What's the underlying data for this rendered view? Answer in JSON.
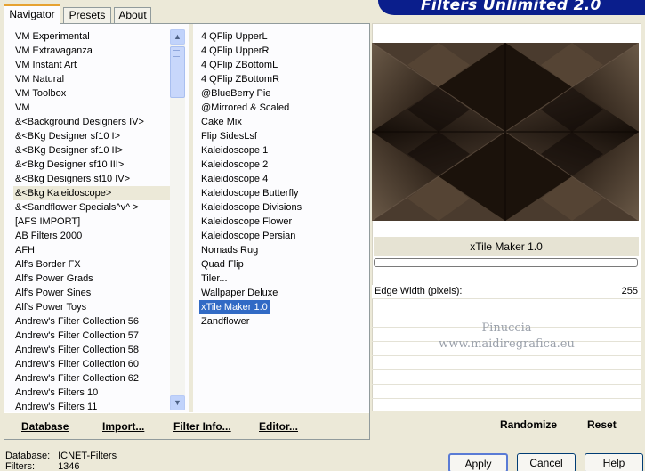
{
  "banner": {
    "title": "Filters Unlimited 2.0"
  },
  "tabs": [
    {
      "label": "Navigator"
    },
    {
      "label": "Presets"
    },
    {
      "label": "About"
    }
  ],
  "categories": [
    "VM Experimental",
    "VM Extravaganza",
    "VM Instant Art",
    "VM Natural",
    "VM Toolbox",
    "VM",
    "&<Background Designers IV>",
    "&<BKg Designer sf10 I>",
    "&<BKg Designer sf10 II>",
    "&<Bkg Designer sf10 III>",
    "&<Bkg Designers sf10 IV>",
    "&<Bkg Kaleidoscope>",
    "&<Sandflower Specials^v^ >",
    "[AFS IMPORT]",
    "AB Filters 2000",
    "AFH",
    "Alf's Border FX",
    "Alf's Power Grads",
    "Alf's Power Sines",
    "Alf's Power Toys",
    "Andrew's Filter Collection 56",
    "Andrew's Filter Collection 57",
    "Andrew's Filter Collection 58",
    "Andrew's Filter Collection 60",
    "Andrew's Filter Collection 62",
    "Andrew's Filters 10",
    "Andrew's Filters 11"
  ],
  "selected_category": "&<Bkg Kaleidoscope>",
  "filters": [
    "4 QFlip UpperL",
    "4 QFlip UpperR",
    "4 QFlip ZBottomL",
    "4 QFlip ZBottomR",
    "@BlueBerry Pie",
    "@Mirrored & Scaled",
    "Cake Mix",
    "Flip SidesLsf",
    "Kaleidoscope 1",
    "Kaleidoscope 2",
    "Kaleidoscope 4",
    "Kaleidoscope Butterfly",
    "Kaleidoscope Divisions",
    "Kaleidoscope Flower",
    "Kaleidoscope Persian",
    "Nomads Rug",
    "Quad Flip",
    "Tiler...",
    "Wallpaper Deluxe",
    "xTile Maker 1.0",
    "Zandflower"
  ],
  "selected_filter": "xTile Maker 1.0",
  "left_bottom": {
    "database": "Database",
    "import": "Import...",
    "filter_info": "Filter Info...",
    "editor": "Editor..."
  },
  "preview": {
    "filter_title": "xTile Maker 1.0",
    "progress": 0
  },
  "params": [
    {
      "label": "Edge Width (pixels):",
      "value": "255"
    }
  ],
  "watermark": {
    "line1": "Pinuccia",
    "line2": "www.maidiregrafica.eu"
  },
  "right_bottom": {
    "randomize": "Randomize",
    "reset": "Reset"
  },
  "status": {
    "database_key": "Database:",
    "database_value": "ICNET-Filters",
    "filters_key": "Filters:",
    "filters_value": "1346"
  },
  "buttons": {
    "apply": "Apply",
    "cancel": "Cancel",
    "help": "Help"
  },
  "colors": {
    "banner": "#0a1e8c",
    "selection": "#316ac5",
    "preview_bg": "#24170f"
  }
}
